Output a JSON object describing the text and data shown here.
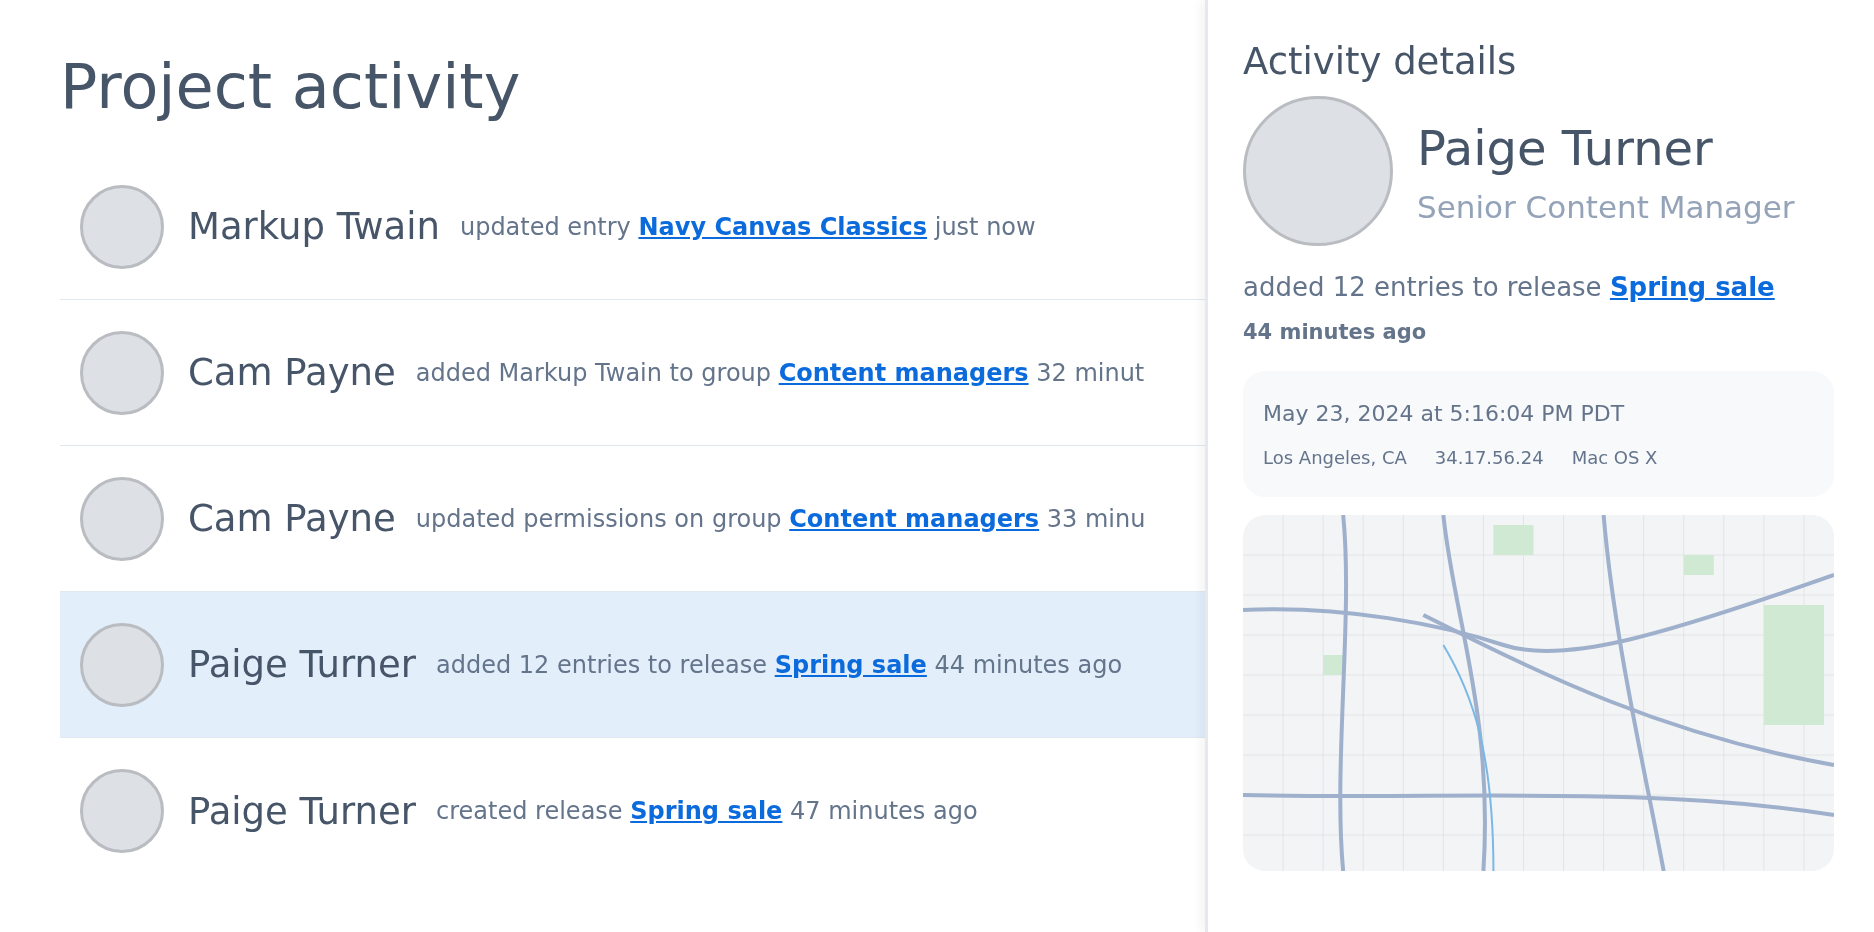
{
  "title": "Project activity",
  "activities": [
    {
      "name": "Markup Twain",
      "action": "updated entry",
      "link": "Navy Canvas Classics",
      "time": "just now",
      "selected": false
    },
    {
      "name": "Cam Payne",
      "action": "added Markup Twain to group",
      "link": "Content managers",
      "time": "32 minut",
      "selected": false
    },
    {
      "name": "Cam Payne",
      "action": "updated permissions on group",
      "link": "Content managers",
      "time": "33 minu",
      "selected": false
    },
    {
      "name": "Paige Turner",
      "action": "added 12 entries to release",
      "link": "Spring sale",
      "time": "44 minutes ago",
      "selected": true
    },
    {
      "name": "Paige Turner",
      "action": "created release",
      "link": "Spring sale",
      "time": "47 minutes ago",
      "selected": false
    }
  ],
  "details": {
    "title": "Activity details",
    "name": "Paige Turner",
    "role": "Senior Content Manager",
    "action": "added 12 entries to release",
    "link": "Spring sale",
    "time": "44 minutes ago",
    "timestamp": "May 23, 2024 at 5:16:04 PM PDT",
    "location": "Los Angeles, CA",
    "ip": "34.17.56.24",
    "os": "Mac OS X"
  }
}
